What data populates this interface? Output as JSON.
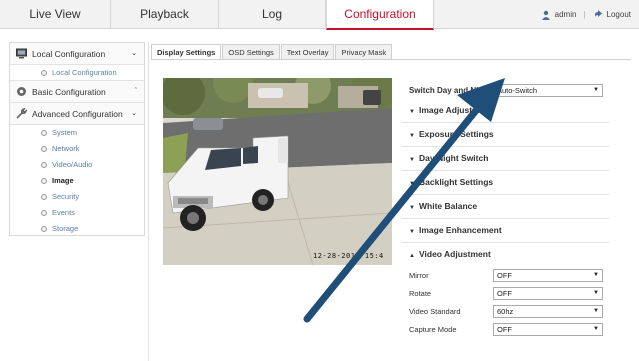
{
  "nav": {
    "tabs": [
      "Live View",
      "Playback",
      "Log",
      "Configuration"
    ],
    "active": "Configuration",
    "user": "admin",
    "separator": "|",
    "logout": "Logout"
  },
  "sidebar": {
    "local": {
      "label": "Local Configuration",
      "items": [
        "Local Configuration"
      ]
    },
    "basic": {
      "label": "Basic Configuration"
    },
    "advanced": {
      "label": "Advanced Configuration",
      "items": [
        "System",
        "Network",
        "Video/Audio",
        "Image",
        "Security",
        "Events",
        "Storage"
      ],
      "active": "Image"
    }
  },
  "content_tabs": [
    "Display Settings",
    "OSD Settings",
    "Text Overlay",
    "Privacy Mask"
  ],
  "video": {
    "osd_text": "12-28-2015 15:4"
  },
  "panel": {
    "switch_label": "Switch Day and Ni...",
    "switch_value": "Auto-Switch",
    "groups": [
      "Image Adjustment",
      "Exposure Settings",
      "Day/Night Switch",
      "Backlight Settings",
      "White Balance",
      "Image Enhancement",
      "Video Adjustment"
    ],
    "video_adjustment": [
      {
        "label": "Mirror",
        "value": "OFF"
      },
      {
        "label": "Rotate",
        "value": "OFF"
      },
      {
        "label": "Video Standard",
        "value": "60hz"
      },
      {
        "label": "Capture Mode",
        "value": "OFF"
      }
    ]
  },
  "colors": {
    "accent": "#c8102e",
    "arrow": "#1f4f78",
    "link": "#5a7fa8"
  }
}
